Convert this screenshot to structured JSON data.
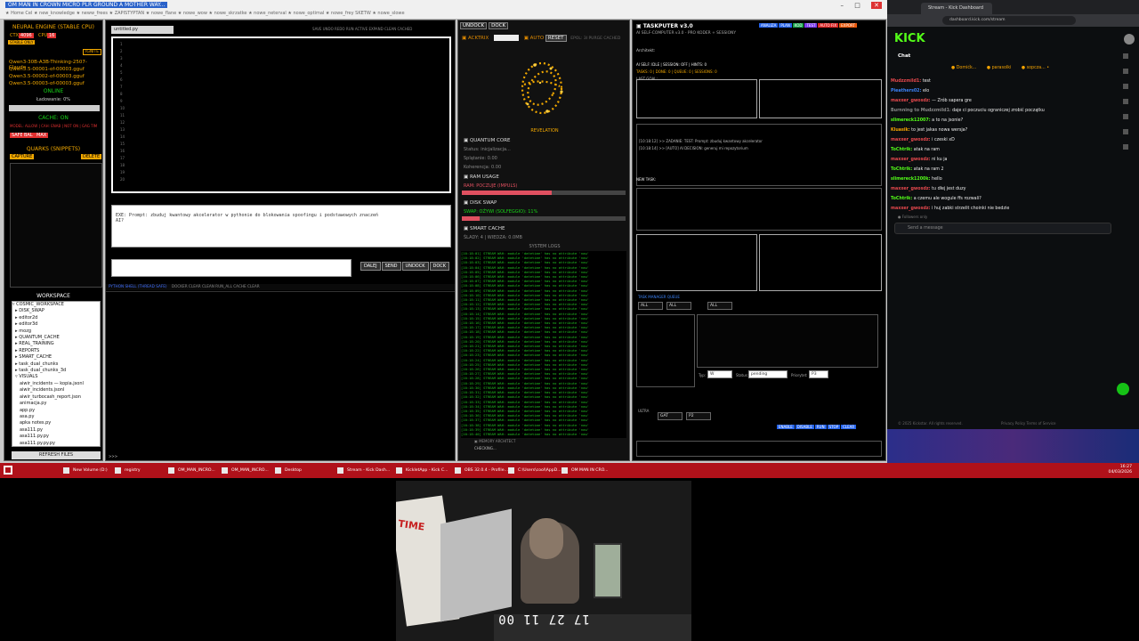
{
  "browser": {
    "tab_title": "OM MAN IN CROWN MICRO PLR GROUND A MOTHER WAY...",
    "bookmarks": "★ Home  Cel  ★ new_knowledge  ★ neww_frees  ★ ZAPISTYPTAN  ★ nowe_flane  ★ nowe_wow  ★ nowe_skrzatke  ★ nowe_neterval  ★ nowe_optimal  ★ nowe_frey  SKETW  ★ nowe_slowe"
  },
  "neural": {
    "title": "NEURAL ENGINE (STABLE CPU)",
    "ctx_label": "CTX",
    "ctx_value": "4096",
    "cpu_label": "CPU",
    "cpu_value": "16",
    "stable_tag": "STABLE ONLY",
    "ignite": "IGNITE",
    "models": [
      "Qwen3-30B-A3B-Thinking-2507-Claude",
      "Qwen3.5-00001-of-00003.gguf",
      "Qwen3.5-00002-of-00003.gguf",
      "Qwen3.5-00003-of-00003.gguf"
    ],
    "status": "ONLINE",
    "loading": "Ładowanie: 0%",
    "cache_status": "CACHE: ON",
    "cache_line": "MODEL: ALLOW | CAH: ENAB | NOT ON | GAG TIM",
    "buttons": [
      "SAFE",
      "BAL",
      "MAX"
    ],
    "quarks_title": "QUARKS (SNIPPETS)",
    "capture": "CAPTURE",
    "delete": "DELETE",
    "workspace_title": "WORKSPACE",
    "tree": [
      "▿ COSMIC_WORKSPACE",
      "  ▸ DISK_SWAP",
      "  ▸ editor2d",
      "  ▸ editor3d",
      "  ▸ mozg",
      "  ▸ QUANTUM_CACHE",
      "  ▸ REAL_TRAINING",
      "  ▸ REPORTS",
      "  ▸ SMART_CACHE",
      "  ▸ task_dual_chunks",
      "  ▸ task_dual_chunks_3d",
      "  ▿ VISUALS",
      "     aiwir_incidents — kopia.jsonl",
      "     aiwir_incidents.jsonl",
      "     aiwir_turbocash_report.json",
      "     animacja.py",
      "     app.py",
      "     asa.py",
      "     apka notes.py",
      "     asa111.py",
      "     asa111.py.py",
      "     asa111.py.py.py"
    ],
    "refresh": "REFRESH FILES"
  },
  "editor": {
    "tab": "untitled.py",
    "toolbar": "SAVE  UNDO  REDO  RUN  ACTIVE  EXPAND  CLEAN  CACHED",
    "line_numbers": [
      "1",
      "2",
      "3",
      "4",
      "5",
      "6",
      "7",
      "8",
      "9",
      "10",
      "11",
      "12",
      "13",
      "14",
      "15",
      "16",
      "17",
      "18",
      "19",
      "20"
    ],
    "prompt_text": "EXE: Prompt: zbuduj kwantowy akcelerator w pythonie do blokowania spoofingu i podstawowych znaczeń\nAI?",
    "send_buttons": [
      "DALEJ",
      "SEND",
      "UNDOCK",
      "DOCK"
    ],
    "shell_title": "PYTHON SHELL (THREAD SAFE)",
    "shell_buttons": "DOCKER  CLEAR  CLEAN  RUN_ALL  CACHE  CLEAR",
    "shell_prompt": ">>>"
  },
  "quantum": {
    "tabs": [
      "UNDOCK",
      "DOCK"
    ],
    "active": "ACKTRIX",
    "auto": "AUTO",
    "reset": "RESET",
    "mode_label": "EPOL: 3I  PURGE  CACHED",
    "revelation": "REVELATION",
    "core_title": "QUANTUM CORE",
    "status": "Status: inicjalizacja...",
    "splatanie": "Splątanie: 0.00",
    "koherencja": "Koherencja: 0.00",
    "ram_title": "RAM USAGE",
    "ram_status": "RAM: POCZUJE (IMPULS)",
    "ram_fill": 0.55,
    "disk_title": "DISK SWAP",
    "disk_status": "SWAP: OŻYWI (SOLFEGGIO): 11%",
    "disk_fill": 0.11,
    "smart_title": "SMART CACHE",
    "smart_status": "ŚLADY: 4 | WIEDZA: 0.0MB",
    "logs_title": "SYSTEM LOGS",
    "log_lines": [
      "[10:18:01] STREAM WAH: module 'datetime' has no attribute 'now'",
      "[10:18:02] STREAM WAH: module 'datetime' has no attribute 'now'",
      "[10:18:03] STREAM WAH: module 'datetime' has no attribute 'now'",
      "[10:18:04] STREAM WAH: module 'datetime' has no attribute 'now'",
      "[10:18:05] STREAM WAH: module 'datetime' has no attribute 'now'",
      "[10:18:06] STREAM WAH: module 'datetime' has no attribute 'now'",
      "[10:18:07] STREAM WAH: module 'datetime' has no attribute 'now'",
      "[10:18:08] STREAM WAH: module 'datetime' has no attribute 'now'",
      "[10:18:09] STREAM WAH: module 'datetime' has no attribute 'now'",
      "[10:18:10] STREAM WAH: module 'datetime' has no attribute 'now'",
      "[10:18:11] STREAM WAH: module 'datetime' has no attribute 'now'",
      "[10:18:12] STREAM WAH: module 'datetime' has no attribute 'now'",
      "[10:18:13] STREAM WAH: module 'datetime' has no attribute 'now'",
      "[10:18:14] STREAM WAH: module 'datetime' has no attribute 'now'",
      "[10:18:15] STREAM WAH: module 'datetime' has no attribute 'now'",
      "[10:18:16] STREAM WAH: module 'datetime' has no attribute 'now'",
      "[10:18:17] STREAM WAH: module 'datetime' has no attribute 'now'",
      "[10:18:18] STREAM WAH: module 'datetime' has no attribute 'now'",
      "[10:18:19] STREAM WAH: module 'datetime' has no attribute 'now'",
      "[10:18:20] STREAM WAH: module 'datetime' has no attribute 'now'",
      "[10:18:21] STREAM WAH: module 'datetime' has no attribute 'now'",
      "[10:18:22] STREAM WAH: module 'datetime' has no attribute 'now'",
      "[10:18:23] STREAM WAH: module 'datetime' has no attribute 'now'",
      "[10:18:24] STREAM WAH: module 'datetime' has no attribute 'now'",
      "[10:18:25] STREAM WAH: module 'datetime' has no attribute 'now'",
      "[10:18:26] STREAM WAH: module 'datetime' has no attribute 'now'",
      "[10:18:27] STREAM WAH: module 'datetime' has no attribute 'now'",
      "[10:18:28] STREAM WAH: module 'datetime' has no attribute 'now'",
      "[10:18:29] STREAM WAH: module 'datetime' has no attribute 'now'",
      "[10:18:30] STREAM WAH: module 'datetime' has no attribute 'now'",
      "[10:18:31] STREAM WAH: module 'datetime' has no attribute 'now'",
      "[10:18:32] STREAM WAH: module 'datetime' has no attribute 'now'",
      "[10:18:33] STREAM WAH: module 'datetime' has no attribute 'now'",
      "[10:18:34] STREAM WAH: module 'datetime' has no attribute 'now'",
      "[10:18:35] STREAM WAH: module 'datetime' has no attribute 'now'",
      "[10:18:36] STREAM WAH: module 'datetime' has no attribute 'now'",
      "[10:18:37] STREAM WAH: module 'datetime' has no attribute 'now'",
      "[10:18:38] STREAM WAH: module 'datetime' has no attribute 'now'",
      "[10:18:39] STREAM WAH: module 'datetime' has no attribute 'now'",
      "[10:18:40] STREAM WAH: module 'datetime' has no attribute 'now'"
    ],
    "memory_label": "MEMORY ARCHITECT",
    "checking": "CHECKING..."
  },
  "taskputer": {
    "title": "TASKPUTER v3.0",
    "subtitle": "AI SELF-COMPUTER v3.0 - PRO KODER + SESSIONY",
    "architekt": "Architekt:",
    "status_line": "AI SELF: IDLE | SESSION: OFF | HINTS: 0",
    "counters": "TASKS: 0 | DONE: 0 | QUEUE: 0 | SESSIONS: 0",
    "last_goal": "LAST GOAL:",
    "buttons": [
      "ANALIZA",
      "PLAN",
      "KOD",
      "TEST",
      "AUTO FIX",
      "EXPORT"
    ],
    "log_a": "[10:18:12] >> ZADANIE: TEST: Prompt: zbuduj kwantowy akcelerator",
    "log_b": "[10:18:14] >> [AUTO] AI DECISION: generuj mi repozytorium",
    "new_task": "NEW TASK:",
    "selects": [
      "ALL",
      "ALL",
      "ALL"
    ],
    "typ_label": "Typ:",
    "typ_value": "W",
    "status_label": "Status:",
    "status_value": "pending",
    "priority_label": "Priorytet:",
    "priority_value": "P3",
    "bottom_select": "GAT",
    "bottom_value": "P2",
    "queue_label": "TASK MANAGER QUEUE",
    "prompt_label": "ULTRA",
    "bottom_btns": [
      "ENABLE",
      "DISABLE",
      "RUN",
      "STOP",
      "CLEAR"
    ]
  },
  "kick": {
    "tab_title": "Stream - Kick Dashboard",
    "url": "dashboard.kick.com/stream",
    "logo": "KICK",
    "chat_title": "Chat",
    "pinned": [
      "● Domićk...",
      "● parasolki",
      "● sopcza... •"
    ],
    "messages": [
      {
        "user": "Mudzzmild1:",
        "text": " test",
        "color": "#e5484d"
      },
      {
        "user": "Pieathers02:",
        "text": " elo",
        "color": "#3b82f6"
      },
      {
        "user": "maxxer_gwosdz:",
        "text": " — Zrób sapera gre",
        "color": "#e5484d"
      },
      {
        "user": "Burnning to Mudzzmild1",
        "text": ": daje ci poczuciu ograniczej zrobić początku",
        "color": "#888"
      },
      {
        "user": "slimereck12007:",
        "text": " a to na jsonie?",
        "color": "#53fc18"
      },
      {
        "user": "Kluasik:",
        "text": " to jest jakas nowa wersja?",
        "color": "#f4a300"
      },
      {
        "user": "maxxer_gwosdz:",
        "text": " i czeski xD",
        "color": "#e5484d"
      },
      {
        "user": "ToChtrik:",
        "text": " atak na ram",
        "color": "#53fc18"
      },
      {
        "user": "maxxer_gwosdz:",
        "text": " ni ku ja",
        "color": "#e5484d"
      },
      {
        "user": "ToChtrik:",
        "text": " atak na ram 2",
        "color": "#53fc18"
      },
      {
        "user": "slimereck1200k:",
        "text": " hello",
        "color": "#53fc18"
      },
      {
        "user": "maxxer_gwosdz:",
        "text": " tu dłej jest duzy",
        "color": "#e5484d"
      },
      {
        "user": "ToChtrik:",
        "text": " a czemu ale wogule ffs rozwali?",
        "color": "#53fc18"
      },
      {
        "user": "maxxer_gwosdz:",
        "text": " i huj zabki strzelit choinki nie bedzie",
        "color": "#e5484d"
      }
    ],
    "follower_line": "● Followers only",
    "send_placeholder": "Send a message",
    "footer": "© 2025 Kickstar. All rights reserved.",
    "footer_links": "Privacy Policy     Terms of Service"
  },
  "taskbar": {
    "apps": [
      "New Volume (D:)",
      "registry",
      "OM_MAN_INCRO...",
      "OM_MAN_INCRO...",
      "Desktop",
      "Stream - Kick Dash...",
      "KickletApp - Kick C...",
      "OBS 32.0.4 - Profile...",
      "C:\\Users\\cool\\AppD...",
      "OM MAN IN CRO..."
    ],
    "time": "16:27",
    "date": "04/03/2026",
    "lang": "POL\nPLP"
  },
  "webcam": {
    "clock": "17 27 11 00",
    "sign_text": "TIME"
  }
}
